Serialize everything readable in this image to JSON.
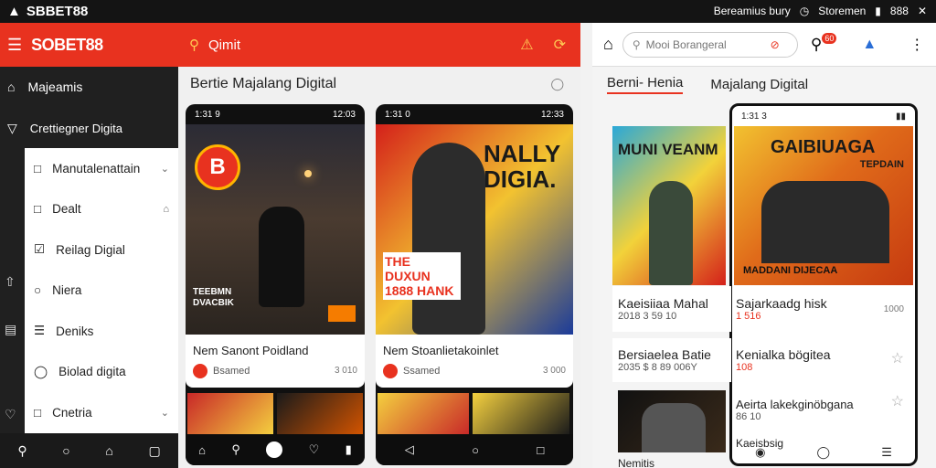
{
  "statusbar": {
    "brand": "SBBET88",
    "right_text": "Bereamius bury",
    "right_text2": "Storemen",
    "time": "888"
  },
  "sidebar": {
    "logo": "SOBET88",
    "items": [
      {
        "label": "Majeamis",
        "icon": "home-icon"
      },
      {
        "label": "Crettiegner Digita",
        "icon": "filter-icon"
      }
    ],
    "drawer": [
      {
        "label": "Manutalenattain",
        "icon": "square-icon",
        "chev": "⌄"
      },
      {
        "label": "Dealt",
        "icon": "square-icon",
        "chev": "⌂"
      },
      {
        "label": "Reilag Digial",
        "icon": "square-icon"
      },
      {
        "label": "Niera",
        "icon": "circle-icon"
      },
      {
        "label": "Deniks",
        "icon": "list-icon"
      },
      {
        "label": "Biolad digita",
        "icon": "chat-icon"
      },
      {
        "label": "Cnetria",
        "icon": "square-icon",
        "chev": "⌄"
      }
    ]
  },
  "middle": {
    "header_title": "Qimit",
    "page_title": "Bertie Majalang Digital",
    "cards": [
      {
        "status_left": "1:31 9",
        "status_right": "12:03",
        "title": "Nem Sanont Poidland",
        "meta": "Bsamed",
        "price": "3 010",
        "bottom_title": ""
      },
      {
        "status_left": "1:31 0",
        "status_right": "12:33",
        "title": "Nem Stoanlietakoinlet",
        "meta": "Ssamed",
        "price": "3 000",
        "bottom_title": ""
      }
    ],
    "card1_sign_top": "B",
    "card1_caption": "TEEBMN DVACBIK",
    "card2_headline": "NALLY DIGIA.",
    "card2_sub": "THE DUXUN 1888 HANK"
  },
  "right": {
    "search_placeholder": "Mooi Borangeral",
    "tab1": "Berni- Henia",
    "tab2": "Majalang Digital",
    "overlay_status": "1:31 3",
    "poster_left": "MUNI VEANM",
    "poster_right_title": "GAIBIUAGA",
    "poster_right_sub": "TEPDAIN",
    "poster_right_caption": "MADDANI DIJECAA",
    "rows": [
      {
        "left_title": "Kaeisiiaa Mahal",
        "left_sub": "2018 3 59 10",
        "right_title": "Sajarkaadg hisk",
        "right_sub": "1 516",
        "right_price": "1000"
      },
      {
        "left_title": "Bersiaelea Batie",
        "left_sub": "2035 $ 8 89 006Y",
        "right_title": "Kenialka bögitea",
        "right_sub": "108",
        "right_price": ""
      },
      {
        "left_title": "Nemitis",
        "left_sub": "",
        "right_title": "Aeirta lakekginöbgana",
        "right_sub": "86 10",
        "right_price": ""
      },
      {
        "left_title": "",
        "left_sub": "",
        "right_title": "Kaeisbsig",
        "right_sub": "",
        "right_price": ""
      }
    ]
  },
  "colors": {
    "accent": "#e8321f",
    "dark": "#202020"
  }
}
